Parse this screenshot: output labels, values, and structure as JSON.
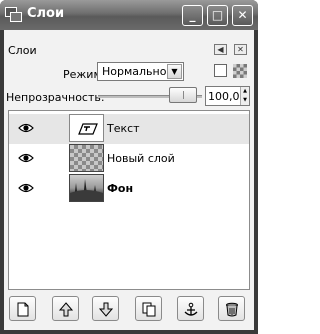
{
  "window": {
    "title": "Слои",
    "controls": [
      "minimize",
      "maximize",
      "close"
    ],
    "minimize_glyph": "_",
    "maximize_glyph": "□",
    "close_glyph": "✕"
  },
  "dock": {
    "title": "Слои",
    "menu_glyph": "◀",
    "close_glyph": "✕"
  },
  "mode": {
    "label": "Режим:",
    "value": "Нормальное",
    "arrow_glyph": "▼"
  },
  "opacity": {
    "label": "Непрозрачность:",
    "value": "100,0",
    "level_percent": 100
  },
  "layers": [
    {
      "name": "Текст",
      "visible": true,
      "selected": true,
      "bold": false,
      "thumbnail": "text-layer-icon"
    },
    {
      "name": "Новый слой",
      "visible": true,
      "selected": false,
      "bold": false,
      "thumbnail": "transparent-checker"
    },
    {
      "name": "Фон",
      "visible": true,
      "selected": false,
      "bold": true,
      "thumbnail": "photo"
    }
  ],
  "toolbar": {
    "buttons": [
      "new-layer-icon",
      "raise-layer-icon",
      "lower-layer-icon",
      "duplicate-layer-icon",
      "anchor-layer-icon",
      "delete-layer-icon"
    ]
  },
  "colors": {
    "titlebar": "#6e6e6e",
    "panel": "#f2f2f2",
    "selected_row": "#e6e6e6"
  }
}
